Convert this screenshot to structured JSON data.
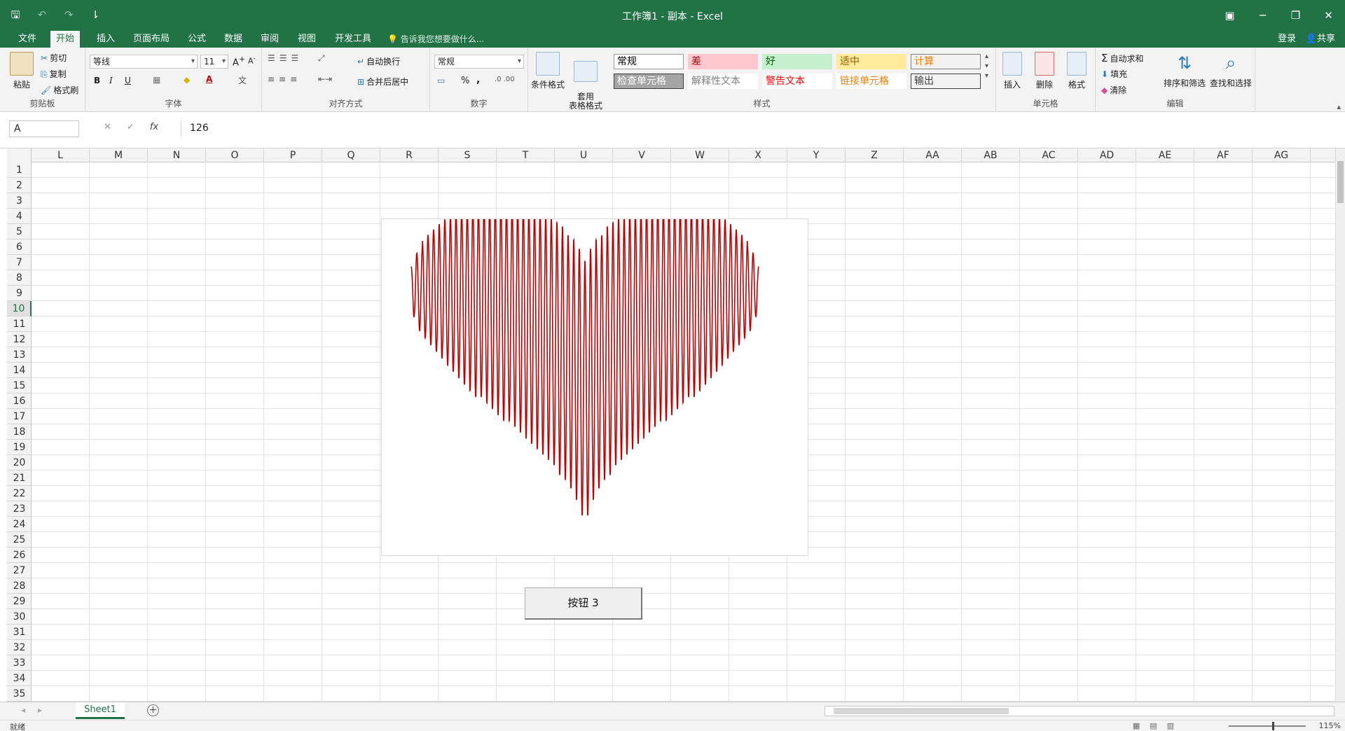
{
  "titlebar": {
    "title": "工作簿1 - 副本 - Excel",
    "qat_save": "🖫",
    "qat_undo": "↶",
    "qat_redo": "↷",
    "qat_customize": "⇂",
    "win_ribbon_opts": "▣",
    "win_minimize": "─",
    "win_restore": "❐",
    "win_close": "✕"
  },
  "tabs": {
    "items": [
      "文件",
      "开始",
      "插入",
      "页面布局",
      "公式",
      "数据",
      "审阅",
      "视图",
      "开发工具"
    ],
    "active": "开始",
    "tellme": "告诉我您想要做什么...",
    "login": "登录",
    "share": "共享"
  },
  "ribbon": {
    "clipboard": {
      "label": "剪贴板",
      "paste": "粘贴",
      "cut": "剪切",
      "copy": "复制",
      "format_painter": "格式刷"
    },
    "font": {
      "label": "字体",
      "font_name": "等线",
      "font_size": "11",
      "bold": "B",
      "italic": "I",
      "underline": "U"
    },
    "alignment": {
      "label": "对齐方式",
      "wrap_text": "自动换行",
      "merge_center": "合并后居中"
    },
    "number": {
      "label": "数字",
      "format": "常规",
      "percent": "%",
      "comma": ","
    },
    "conditional_format": "条件格式",
    "table_format": "套用\n表格格式",
    "styles": {
      "label": "样式",
      "items": [
        {
          "text": "常规",
          "bg": "#ffffff",
          "color": "#000000",
          "border": "#9b9b9b"
        },
        {
          "text": "差",
          "bg": "#ffc7ce",
          "color": "#9c0006",
          "border": "#ffc7ce"
        },
        {
          "text": "好",
          "bg": "#c6efce",
          "color": "#006100",
          "border": "#c6efce"
        },
        {
          "text": "适中",
          "bg": "#ffeb9c",
          "color": "#9c5700",
          "border": "#ffeb9c"
        },
        {
          "text": "计算",
          "bg": "#f2f2f2",
          "color": "#fa7d00",
          "border": "#7f7f7f"
        },
        {
          "text": "检查单元格",
          "bg": "#a5a5a5",
          "color": "#ffffff",
          "border": "#3f3f3f"
        },
        {
          "text": "解释性文本",
          "bg": "#ffffff",
          "color": "#7f7f7f",
          "border": "#ffffff"
        },
        {
          "text": "警告文本",
          "bg": "#ffffff",
          "color": "#ff0000",
          "border": "#ffffff"
        },
        {
          "text": "链接单元格",
          "bg": "#ffffff",
          "color": "#fa7d00",
          "border": "#ffffff"
        },
        {
          "text": "输出",
          "bg": "#f2f2f2",
          "color": "#3f3f3f",
          "border": "#3f3f3f"
        }
      ]
    },
    "cells": {
      "label": "单元格",
      "insert": "插入",
      "delete": "删除",
      "format": "格式"
    },
    "editing": {
      "label": "编辑",
      "autosum": "自动求和",
      "fill": "填充",
      "clear": "清除",
      "sort_filter": "排序和筛选",
      "find_select": "查找和选择"
    }
  },
  "formula_bar": {
    "name_box": "A",
    "cancel": "✕",
    "enter": "✓",
    "fx": "fx",
    "value": "126"
  },
  "grid": {
    "columns": [
      "L",
      "M",
      "N",
      "O",
      "P",
      "Q",
      "R",
      "S",
      "T",
      "U",
      "V",
      "W",
      "X",
      "Y",
      "Z",
      "AA",
      "AB",
      "AC",
      "AD",
      "AE",
      "AF",
      "AG",
      "A"
    ],
    "rows": [
      "1",
      "2",
      "3",
      "4",
      "5",
      "6",
      "7",
      "8",
      "9",
      "10",
      "11",
      "12",
      "13",
      "14",
      "15",
      "16",
      "17",
      "18",
      "19",
      "20",
      "21",
      "22",
      "23",
      "24",
      "25",
      "26",
      "27",
      "28",
      "29",
      "30",
      "31",
      "32",
      "33",
      "34",
      "35"
    ],
    "active_row": "10"
  },
  "chart_data": {
    "type": "line",
    "description_visible": false,
    "series": [
      {
        "name": "",
        "color": "#c00000",
        "shape": "heart",
        "oscillations": 62
      }
    ],
    "title": "",
    "xlabel": "",
    "ylabel": "",
    "grid": false,
    "legend": "none"
  },
  "form_button": {
    "label": "按钮 3"
  },
  "sheetbar": {
    "sheet_name": "Sheet1",
    "add_sheet": "⊕",
    "nav_prev": "◂",
    "nav_next": "▸"
  },
  "statusbar": {
    "ready": "就绪",
    "zoom": "115%"
  }
}
